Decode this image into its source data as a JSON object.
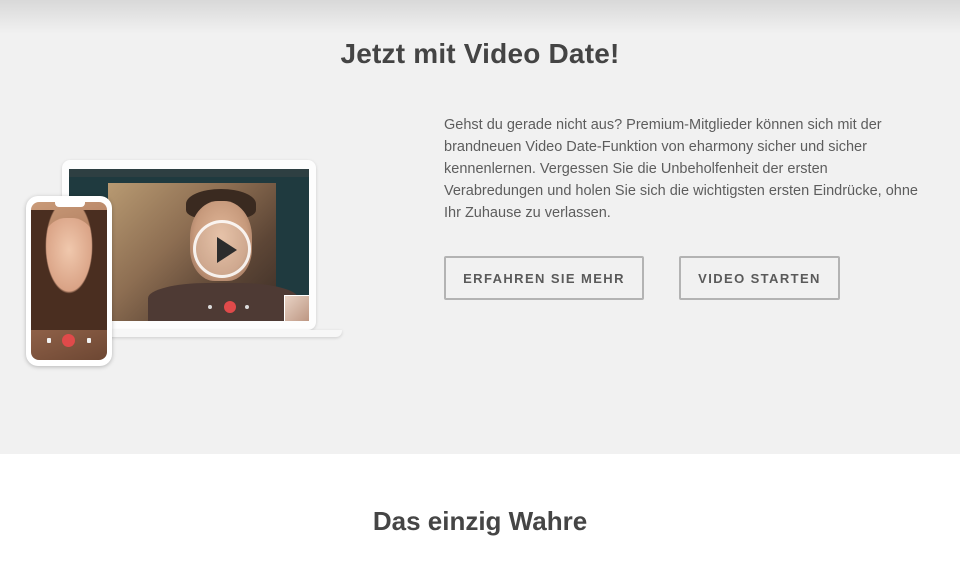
{
  "promo": {
    "title": "Jetzt mit Video Date!",
    "description": "Gehst du gerade nicht aus? Premium-Mitglieder können sich mit der brandneuen Video Date-Funktion von eharmony sicher und sicher kennenlernen. Vergessen Sie die Unbeholfenheit der ersten Verabredungen und holen Sie sich die wichtigsten ersten Eindrücke, ohne Ihr Zuhause zu verlassen.",
    "learn_more_label": "ERFAHREN SIE MEHR",
    "start_video_label": "VIDEO STARTEN",
    "illustration_icons": [
      "play-icon",
      "end-call-icon",
      "microphone-icon",
      "camera-icon"
    ]
  },
  "next_section": {
    "title": "Das einzig Wahre"
  },
  "colors": {
    "promo_background": "#f1f1f1",
    "heading": "#444444",
    "body_text": "#5d5d5d",
    "button_border": "#b3b3b3",
    "end_call_red": "#e04a4a"
  }
}
